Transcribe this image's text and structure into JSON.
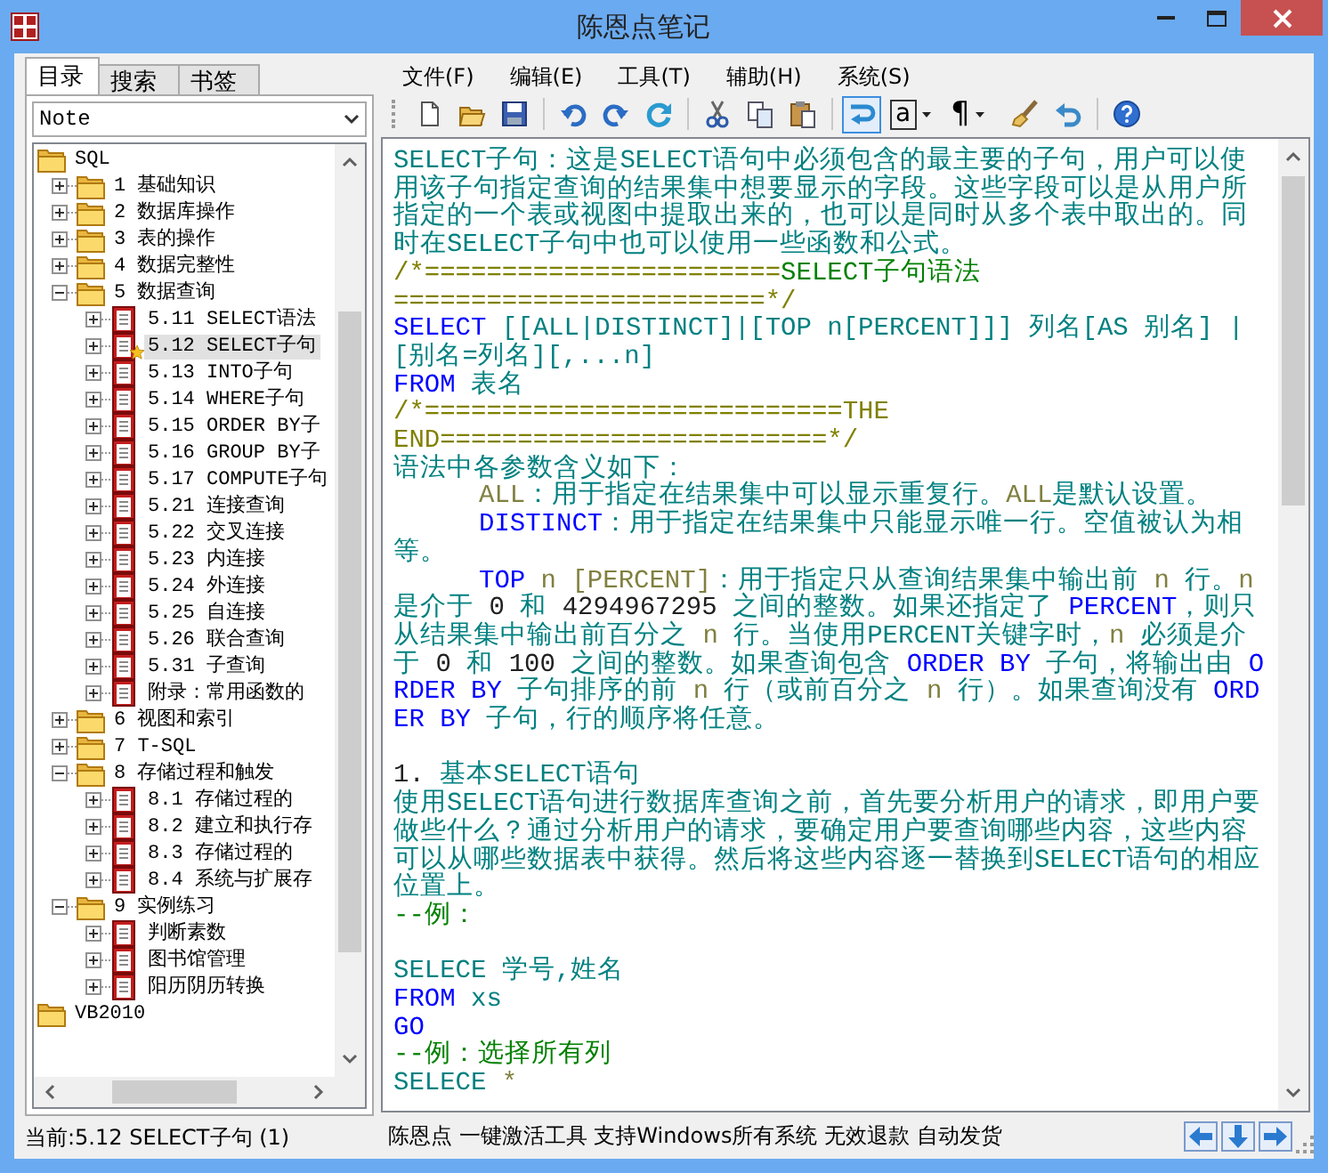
{
  "window": {
    "title": "陈恩点笔记"
  },
  "left_tabs": [
    {
      "label": "目录",
      "selected": true
    },
    {
      "label": "搜索",
      "selected": false
    },
    {
      "label": "书签",
      "selected": false
    }
  ],
  "notebook_select": {
    "value": "Note"
  },
  "tree": {
    "items": [
      {
        "label": "SQL",
        "kind": "folder",
        "selected": false,
        "bookmarked": false,
        "children": [
          {
            "label": "1 基础知识",
            "kind": "folder",
            "expanded": false,
            "selected": false,
            "bookmarked": false
          },
          {
            "label": "2 数据库操作",
            "kind": "folder",
            "expanded": false,
            "selected": false,
            "bookmarked": false
          },
          {
            "label": "3 表的操作",
            "kind": "folder",
            "expanded": false,
            "selected": false,
            "bookmarked": false
          },
          {
            "label": "4 数据完整性",
            "kind": "folder",
            "expanded": false,
            "selected": false,
            "bookmarked": false
          },
          {
            "label": "5 数据查询",
            "kind": "folder",
            "expanded": true,
            "selected": false,
            "bookmarked": false,
            "children": [
              {
                "label": "5.11 SELECT语法",
                "kind": "page",
                "expanded": false,
                "selected": false,
                "bookmarked": false
              },
              {
                "label": "5.12 SELECT子句",
                "kind": "page",
                "expanded": false,
                "selected": true,
                "bookmarked": true
              },
              {
                "label": "5.13 INTO子句",
                "kind": "page",
                "expanded": false,
                "selected": false,
                "bookmarked": false
              },
              {
                "label": "5.14 WHERE子句",
                "kind": "page",
                "expanded": false,
                "selected": false,
                "bookmarked": false
              },
              {
                "label": "5.15 ORDER BY子",
                "kind": "page",
                "expanded": false,
                "selected": false,
                "bookmarked": false
              },
              {
                "label": "5.16 GROUP BY子",
                "kind": "page",
                "expanded": false,
                "selected": false,
                "bookmarked": false
              },
              {
                "label": "5.17 COMPUTE子句",
                "kind": "page",
                "expanded": false,
                "selected": false,
                "bookmarked": false
              },
              {
                "label": "5.21 连接查询",
                "kind": "page",
                "expanded": false,
                "selected": false,
                "bookmarked": false
              },
              {
                "label": "5.22 交叉连接",
                "kind": "page",
                "expanded": false,
                "selected": false,
                "bookmarked": false
              },
              {
                "label": "5.23 内连接",
                "kind": "page",
                "expanded": false,
                "selected": false,
                "bookmarked": false
              },
              {
                "label": "5.24 外连接",
                "kind": "page",
                "expanded": false,
                "selected": false,
                "bookmarked": false
              },
              {
                "label": "5.25 自连接",
                "kind": "page",
                "expanded": false,
                "selected": false,
                "bookmarked": false
              },
              {
                "label": "5.26 联合查询",
                "kind": "page",
                "expanded": false,
                "selected": false,
                "bookmarked": false
              },
              {
                "label": "5.31 子查询",
                "kind": "page",
                "expanded": false,
                "selected": false,
                "bookmarked": false
              },
              {
                "label": "附录：常用函数的",
                "kind": "page",
                "expanded": false,
                "selected": false,
                "bookmarked": false
              }
            ]
          },
          {
            "label": "6 视图和索引",
            "kind": "folder",
            "expanded": false,
            "selected": false,
            "bookmarked": false
          },
          {
            "label": "7 T-SQL",
            "kind": "folder",
            "expanded": false,
            "selected": false,
            "bookmarked": false
          },
          {
            "label": "8 存储过程和触发",
            "kind": "folder",
            "expanded": true,
            "selected": false,
            "bookmarked": false,
            "children": [
              {
                "label": "8.1 存储过程的",
                "kind": "page",
                "expanded": false,
                "selected": false,
                "bookmarked": false
              },
              {
                "label": "8.2 建立和执行存",
                "kind": "page",
                "expanded": false,
                "selected": false,
                "bookmarked": false
              },
              {
                "label": "8.3 存储过程的",
                "kind": "page",
                "expanded": false,
                "selected": false,
                "bookmarked": false
              },
              {
                "label": "8.4 系统与扩展存",
                "kind": "page",
                "expanded": false,
                "selected": false,
                "bookmarked": false
              }
            ]
          },
          {
            "label": "9 实例练习",
            "kind": "folder",
            "expanded": true,
            "selected": false,
            "bookmarked": false,
            "children": [
              {
                "label": "判断素数",
                "kind": "page",
                "expanded": false,
                "selected": false,
                "bookmarked": false
              },
              {
                "label": "图书馆管理",
                "kind": "page",
                "expanded": false,
                "selected": false,
                "bookmarked": false
              },
              {
                "label": "阳历阴历转换",
                "kind": "page",
                "expanded": false,
                "selected": false,
                "bookmarked": false
              }
            ]
          }
        ]
      },
      {
        "label": "VB2010",
        "kind": "folder",
        "selected": false,
        "bookmarked": false
      }
    ]
  },
  "left_status": "当前:5.12 SELECT子句 (1)",
  "menu": [
    "文件(F)",
    "编辑(E)",
    "工具(T)",
    "辅助(H)",
    "系统(S)"
  ],
  "toolbar": [
    {
      "kind": "new",
      "on": false
    },
    {
      "kind": "open",
      "on": false
    },
    {
      "kind": "save",
      "on": false
    },
    {
      "kind": "separator",
      "on": false
    },
    {
      "kind": "undo",
      "on": false
    },
    {
      "kind": "redo",
      "on": false
    },
    {
      "kind": "refresh",
      "on": false
    },
    {
      "kind": "separator",
      "on": false
    },
    {
      "kind": "cut",
      "on": false
    },
    {
      "kind": "copy",
      "on": false
    },
    {
      "kind": "paste",
      "on": false
    },
    {
      "kind": "separator",
      "on": false
    },
    {
      "kind": "wrap",
      "on": true
    },
    {
      "kind": "glyph",
      "label": "a",
      "on": false
    },
    {
      "kind": "glyph",
      "label": "¶",
      "on": false
    },
    {
      "kind": "brush",
      "on": false
    },
    {
      "kind": "revert",
      "on": false
    },
    {
      "kind": "separator",
      "on": false
    },
    {
      "kind": "help",
      "on": false
    }
  ],
  "editor": {
    "lines": [
      {
        "kind": "text",
        "indented": false,
        "segments": [
          {
            "kind": "text",
            "text": "SELECT子句：这是SELECT语句中必须包含的最主要的子句，用户可以使用该子句指定查询的结果集中想要显示的字段。这些字段可以是从用户所指定的一个表或视图中提取出来的，也可以是同时从多个表中取出的。同时在SELECT子句中也可以使用一些函数和公式。"
          }
        ]
      },
      {
        "kind": "text",
        "indented": false,
        "segments": [
          {
            "kind": "comment",
            "text": "/*======================="
          },
          {
            "kind": "note",
            "text": "SELECT子句语法"
          }
        ]
      },
      {
        "kind": "text",
        "indented": false,
        "segments": [
          {
            "kind": "comment",
            "text": "========================*/"
          }
        ]
      },
      {
        "kind": "text",
        "indented": false,
        "segments": [
          {
            "kind": "keyword",
            "text": "SELECT"
          },
          {
            "kind": "text",
            "text": " [[ALL|DISTINCT]|[TOP n[PERCENT]]] 列名[AS 别名] | [别名=列名][,...n]"
          }
        ]
      },
      {
        "kind": "text",
        "indented": false,
        "segments": [
          {
            "kind": "keyword",
            "text": "FROM"
          },
          {
            "kind": "text",
            "text": " 表名"
          }
        ]
      },
      {
        "kind": "text",
        "indented": false,
        "segments": [
          {
            "kind": "comment",
            "text": "/*===========================THE"
          }
        ]
      },
      {
        "kind": "text",
        "indented": false,
        "segments": [
          {
            "kind": "comment",
            "text": "END=========================*/"
          }
        ]
      },
      {
        "kind": "text",
        "indented": false,
        "segments": [
          {
            "kind": "text",
            "text": "语法中各参数含义如下："
          }
        ]
      },
      {
        "kind": "text",
        "indented": true,
        "segments": [
          {
            "kind": "param",
            "text": "ALL"
          },
          {
            "kind": "text",
            "text": "：用于指定在结果集中可以显示重复行。"
          },
          {
            "kind": "param",
            "text": "ALL"
          },
          {
            "kind": "text",
            "text": "是默认设置。"
          }
        ]
      },
      {
        "kind": "text",
        "indented": true,
        "segments": [
          {
            "kind": "keyword",
            "text": "DISTINCT"
          },
          {
            "kind": "text",
            "text": "：用于指定在结果集中只能显示唯一行。空值被认为相等。"
          }
        ]
      },
      {
        "kind": "text",
        "indented": true,
        "segments": [
          {
            "kind": "keyword",
            "text": "TOP"
          },
          {
            "kind": "param",
            "text": " n [PERCENT]"
          },
          {
            "kind": "text",
            "text": "：用于指定只从查询结果集中输出前 "
          },
          {
            "kind": "param",
            "text": "n"
          },
          {
            "kind": "text",
            "text": " 行。"
          },
          {
            "kind": "param",
            "text": "n"
          },
          {
            "kind": "text",
            "text": " 是介于 "
          },
          {
            "kind": "number",
            "text": "0"
          },
          {
            "kind": "text",
            "text": " 和 "
          },
          {
            "kind": "number",
            "text": "4294967295"
          },
          {
            "kind": "text",
            "text": " 之间的整数。如果还指定了 "
          },
          {
            "kind": "keyword",
            "text": "PERCENT"
          },
          {
            "kind": "text",
            "text": "，则只从结果集中输出前百分之 "
          },
          {
            "kind": "param",
            "text": "n"
          },
          {
            "kind": "text",
            "text": " 行。当使用PERCENT关键字时，"
          },
          {
            "kind": "param",
            "text": "n"
          },
          {
            "kind": "text",
            "text": " 必须是介于 "
          },
          {
            "kind": "number",
            "text": "0"
          },
          {
            "kind": "text",
            "text": " 和 "
          },
          {
            "kind": "number",
            "text": "100"
          },
          {
            "kind": "text",
            "text": " 之间的整数。如果查询包含 "
          },
          {
            "kind": "keyword",
            "text": "ORDER BY"
          },
          {
            "kind": "text",
            "text": " 子句，将输出由 "
          },
          {
            "kind": "keyword",
            "text": "ORDER BY"
          },
          {
            "kind": "text",
            "text": " 子句排序的前 "
          },
          {
            "kind": "param",
            "text": "n"
          },
          {
            "kind": "text",
            "text": " 行（或前百分之 "
          },
          {
            "kind": "param",
            "text": "n"
          },
          {
            "kind": "text",
            "text": " 行）。如果查询没有 "
          },
          {
            "kind": "keyword",
            "text": "ORDER BY"
          },
          {
            "kind": "text",
            "text": " 子句，行的顺序将任意。"
          }
        ]
      },
      {
        "kind": "blank"
      },
      {
        "kind": "text",
        "indented": false,
        "segments": [
          {
            "kind": "number",
            "text": "1."
          },
          {
            "kind": "text",
            "text": " 基本SELECT语句"
          }
        ]
      },
      {
        "kind": "text",
        "indented": false,
        "segments": [
          {
            "kind": "text",
            "text": "使用SELECT语句进行数据库查询之前，首先要分析用户的请求，即用户要做些什么？通过分析用户的请求，要确定用户要查询哪些内容，这些内容可以从哪些数据表中获得。然后将这些内容逐一替换到SELECT语句的相应位置上。"
          }
        ]
      },
      {
        "kind": "text",
        "indented": false,
        "segments": [
          {
            "kind": "note",
            "text": "--例："
          }
        ]
      },
      {
        "kind": "blank"
      },
      {
        "kind": "text",
        "indented": false,
        "segments": [
          {
            "kind": "text",
            "text": "SELECE 学号,姓名"
          }
        ]
      },
      {
        "kind": "text",
        "indented": false,
        "segments": [
          {
            "kind": "keyword",
            "text": "FROM"
          },
          {
            "kind": "text",
            "text": " xs"
          }
        ]
      },
      {
        "kind": "text",
        "indented": false,
        "segments": [
          {
            "kind": "keyword",
            "text": "GO"
          }
        ]
      },
      {
        "kind": "text",
        "indented": false,
        "segments": [
          {
            "kind": "note",
            "text": "--例：选择所有列"
          }
        ]
      },
      {
        "kind": "text",
        "indented": false,
        "segments": [
          {
            "kind": "text",
            "text": "SELECE"
          },
          {
            "kind": "param",
            "text": " *"
          }
        ]
      }
    ]
  },
  "status_text": "陈恩点 一键激活工具 支持Windows所有系统 无效退款 自动发货"
}
